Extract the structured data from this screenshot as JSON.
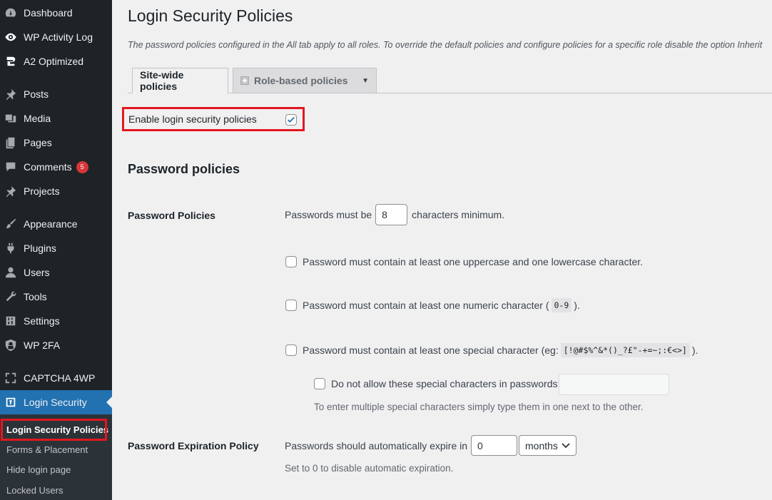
{
  "sidebar": {
    "items": [
      {
        "label": "Dashboard",
        "icon": "dashboard-icon"
      },
      {
        "label": "WP Activity Log",
        "icon": "eye-icon"
      },
      {
        "label": "A2 Optimized",
        "icon": "a2-icon"
      },
      {
        "label": "Posts",
        "icon": "pin-icon"
      },
      {
        "label": "Media",
        "icon": "media-icon"
      },
      {
        "label": "Pages",
        "icon": "pages-icon"
      },
      {
        "label": "Comments",
        "icon": "comment-icon",
        "badge": "5"
      },
      {
        "label": "Projects",
        "icon": "pin-icon"
      },
      {
        "label": "Appearance",
        "icon": "brush-icon"
      },
      {
        "label": "Plugins",
        "icon": "plugin-icon"
      },
      {
        "label": "Users",
        "icon": "user-icon"
      },
      {
        "label": "Tools",
        "icon": "wrench-icon"
      },
      {
        "label": "Settings",
        "icon": "settings-icon"
      },
      {
        "label": "WP 2FA",
        "icon": "shield-icon"
      },
      {
        "label": "CAPTCHA 4WP",
        "icon": "captcha-icon"
      },
      {
        "label": "Login Security",
        "icon": "login-security-icon"
      }
    ],
    "submenu": [
      {
        "label": "Login Security Policies"
      },
      {
        "label": "Forms & Placement"
      },
      {
        "label": "Hide login page"
      },
      {
        "label": "Locked Users"
      }
    ]
  },
  "page": {
    "title": "Login Security Policies",
    "description": "The password policies configured in the All tab apply to all roles. To override the default policies and configure policies for a specific role disable the option Inherit"
  },
  "tabs": {
    "site_wide": "Site-wide policies",
    "role_based": "Role-based policies"
  },
  "enable": {
    "label": "Enable login security policies",
    "checked": true
  },
  "password_policies": {
    "heading": "Password policies",
    "row_label": "Password Policies",
    "min_prefix": "Passwords must be",
    "min_value": "8",
    "min_suffix": "characters minimum.",
    "case_rule": "Password must contain at least one uppercase and one lowercase character.",
    "numeric_rule_prefix": "Password must contain at least one numeric character (",
    "numeric_code": "0-9",
    "numeric_rule_suffix": ").",
    "special_rule_prefix": "Password must contain at least one special character (eg:",
    "special_code": "[!@#$%^&*()_?£\"-+=~;:€<>]",
    "special_rule_suffix": ").",
    "disallow_label": "Do not allow these special characters in passwords:",
    "disallow_hint": "To enter multiple special characters simply type them in one next to the other."
  },
  "expiration": {
    "row_label": "Password Expiration Policy",
    "prefix": "Passwords should automatically expire in",
    "value": "0",
    "unit": "months",
    "hint": "Set to 0 to disable automatic expiration."
  },
  "colors": {
    "sidebar_bg": "#1d2327",
    "active_blue": "#2271b1",
    "highlight_red": "#e3171f",
    "badge_red": "#d63638"
  }
}
